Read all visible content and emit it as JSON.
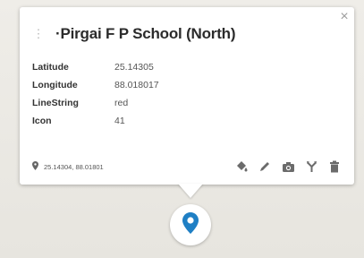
{
  "popup": {
    "title": "·Pirgai F P School (North)",
    "close_label": "×",
    "attributes": [
      {
        "key": "Latitude",
        "value": "25.14305"
      },
      {
        "key": "Longitude",
        "value": "88.018017"
      },
      {
        "key": "LineString",
        "value": "red"
      },
      {
        "key": "Icon",
        "value": "41"
      }
    ],
    "coordinates": "25.14304, 88.01801",
    "tools": [
      "paint-bucket-icon",
      "pencil-icon",
      "camera-icon",
      "directions-icon",
      "trash-icon"
    ]
  },
  "marker": {
    "color": "#1f7fc4",
    "icon": "map-pin-icon"
  }
}
